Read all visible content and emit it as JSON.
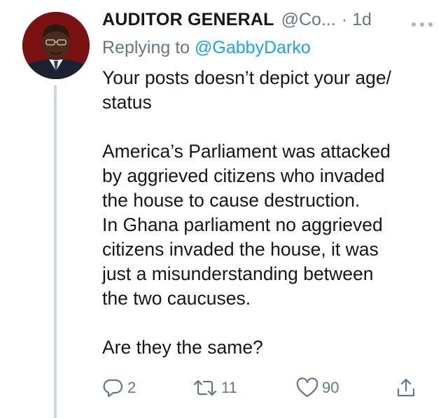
{
  "tweet": {
    "display_name": "AUDITOR GENERAL",
    "handle": "@Co...",
    "time": "· 1d",
    "more_icon": "ellipsis-icon",
    "replying_prefix": "Replying to ",
    "replying_to": "@GabbyDarko",
    "text_lines": [
      "Your posts doesn’t depict your age/",
      "status",
      "America’s Parliament was attacked",
      "by aggrieved citizens who invaded",
      "the house to cause destruction.",
      "In Ghana parliament no aggrieved",
      "citizens invaded the house, it was",
      "just a misunderstanding between",
      "the two caucuses.",
      "Are they the same?"
    ]
  },
  "actions": {
    "reply_count": "2",
    "retweet_count": "11",
    "like_count": "90",
    "icons": [
      "reply-icon",
      "retweet-icon",
      "like-icon",
      "share-icon"
    ]
  },
  "colors": {
    "text": "#14171a",
    "secondary": "#657786",
    "link": "#1da1f2",
    "thread_line": "#ccd6dd"
  }
}
